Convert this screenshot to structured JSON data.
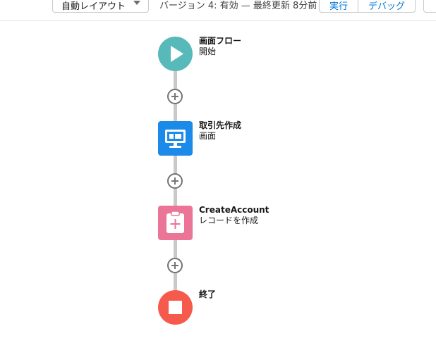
{
  "toolbar": {
    "layout_select": "自動レイアウト",
    "version_status": "バージョン 4: 有効 — 最終更新 8分前",
    "run_label": "実行",
    "debug_label": "デバッグ"
  },
  "flow": {
    "nodes": [
      {
        "title": "画面フロー",
        "subtitle": "開始",
        "icon": "play-icon",
        "color": "#57b9b9"
      },
      {
        "title": "取引先作成",
        "subtitle": "画面",
        "icon": "screen-icon",
        "color": "#1b8ae8"
      },
      {
        "title": "CreateAccount",
        "subtitle": "レコードを作成",
        "icon": "record-create-icon",
        "color": "#ea7597"
      },
      {
        "title": "終了",
        "subtitle": "",
        "icon": "stop-icon",
        "color": "#f65a4c"
      }
    ],
    "connector_color": "#c9c9c9",
    "add_buttons": 3
  }
}
